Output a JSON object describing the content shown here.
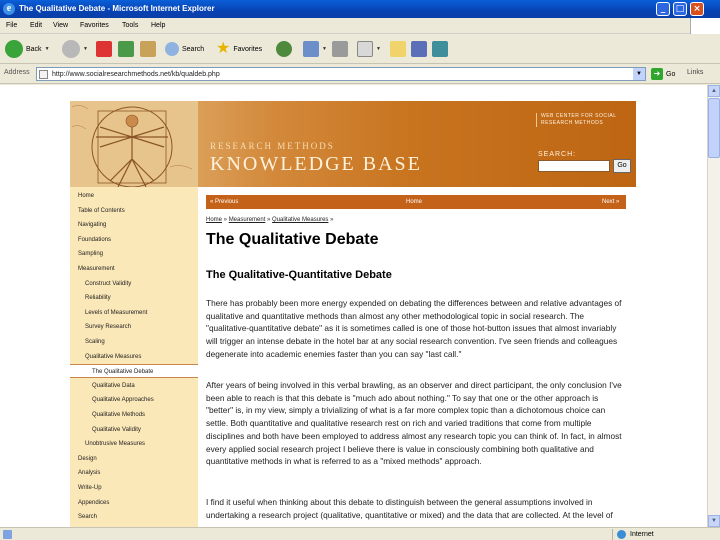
{
  "window": {
    "title": "The Qualitative Debate - Microsoft Internet Explorer",
    "controls": [
      "_",
      "□",
      "×"
    ]
  },
  "menu": [
    "File",
    "Edit",
    "View",
    "Favorites",
    "Tools",
    "Help"
  ],
  "toolbar": {
    "back": "Back",
    "search": "Search",
    "favorites": "Favorites"
  },
  "address": {
    "label": "Address",
    "url": "http://www.socialresearchmethods.net/kb/qualdeb.php",
    "go": "Go",
    "links": "Links"
  },
  "banner": {
    "subtitle": "RESEARCH METHODS",
    "title": "KNOWLEDGE BASE",
    "web_center": "WEB CENTER FOR SOCIAL RESEARCH METHODS",
    "search_label": "SEARCH:",
    "go": "Go"
  },
  "sidebar": {
    "items": [
      {
        "label": "Home",
        "indent": 0
      },
      {
        "label": "Table of Contents",
        "indent": 0
      },
      {
        "label": "Navigating",
        "indent": 0
      },
      {
        "label": "Foundations",
        "indent": 0
      },
      {
        "label": "Sampling",
        "indent": 0
      },
      {
        "label": "Measurement",
        "indent": 0
      },
      {
        "label": "Construct Validity",
        "indent": 1
      },
      {
        "label": "Reliability",
        "indent": 1
      },
      {
        "label": "Levels of Measurement",
        "indent": 1
      },
      {
        "label": "Survey Research",
        "indent": 1
      },
      {
        "label": "Scaling",
        "indent": 1
      },
      {
        "label": "Qualitative Measures",
        "indent": 1
      },
      {
        "label": "The Qualitative Debate",
        "indent": 2,
        "active": true
      },
      {
        "label": "Qualitative Data",
        "indent": 2
      },
      {
        "label": "Qualitative Approaches",
        "indent": 2
      },
      {
        "label": "Qualitative Methods",
        "indent": 2
      },
      {
        "label": "Qualitative Validity",
        "indent": 2
      },
      {
        "label": "Unobtrusive Measures",
        "indent": 1
      },
      {
        "label": "Design",
        "indent": 0
      },
      {
        "label": "Analysis",
        "indent": 0
      },
      {
        "label": "Write-Up",
        "indent": 0
      },
      {
        "label": "Appendices",
        "indent": 0
      },
      {
        "label": "Search",
        "indent": 0
      }
    ]
  },
  "nav": {
    "previous": "« Previous",
    "home": "Home",
    "next": "Next »"
  },
  "breadcrumb": {
    "home": "Home",
    "measurement": "Measurement",
    "qualitative": "Qualitative Measures",
    "sep": " » "
  },
  "content": {
    "title": "The Qualitative Debate",
    "subtitle": "The Qualitative-Quantitative Debate",
    "paragraphs": [
      "There has probably been more energy expended on debating the differences between and relative advantages of qualitative and quantitative methods than almost any other methodological topic in social research. The \"qualitative-quantitative debate\" as it is sometimes called is one of those hot-button issues that almost invariably will trigger an intense debate in the hotel bar at any social research convention. I've seen friends and colleagues degenerate into academic enemies faster than you can say \"last call.\"",
      "After years of being involved in this verbal brawling, as an observer and direct participant, the only conclusion I've been able to reach is that this debate is \"much ado about nothing.\" To say that one or the other approach is \"better\" is, in my view, simply a trivializing of what is a far more complex topic than a dichotomous choice can settle. Both quantitative and qualitative research rest on rich and varied traditions that come from multiple disciplines and both have been employed to address almost any research topic you can think of. In fact, in almost every applied social research project I believe there is value in consciously combining both qualitative and quantitative methods in what is referred to as a \"mixed methods\" approach.",
      "I find it useful when thinking about this debate to distinguish between the general assumptions involved in undertaking a research project (qualitative, quantitative or mixed) and the data that are collected. At the level of"
    ]
  },
  "status": {
    "zone": "Internet"
  }
}
